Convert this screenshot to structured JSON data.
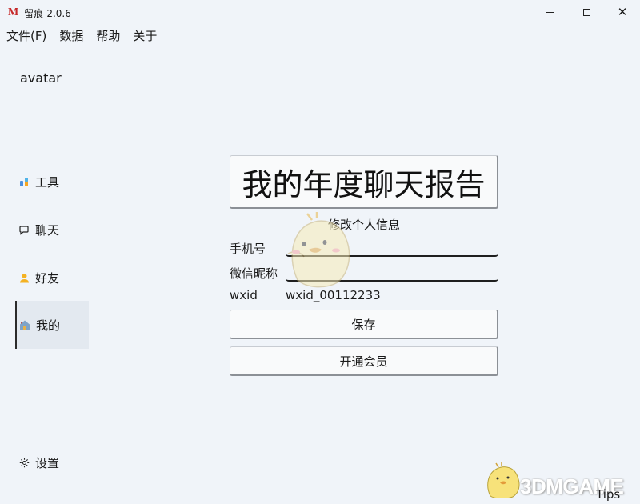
{
  "window": {
    "logo": "M",
    "title": "留痕-2.0.6"
  },
  "menu": [
    "文件(F)",
    "数据",
    "帮助",
    "关于"
  ],
  "sidebar": {
    "avatar": "avatar",
    "items": [
      {
        "label": "工具",
        "icon": "tools-icon"
      },
      {
        "label": "聊天",
        "icon": "chat-icon"
      },
      {
        "label": "好友",
        "icon": "friends-icon"
      },
      {
        "label": "我的",
        "icon": "home-icon",
        "active": true
      }
    ],
    "settings": {
      "label": "设置",
      "icon": "gear-icon"
    }
  },
  "main": {
    "report_button": "我的年度聊天报告",
    "section_title": "修改个人信息",
    "fields": {
      "phone_label": "手机号",
      "phone_value": "",
      "nickname_label": "微信昵称",
      "nickname_value": "",
      "wxid_label": "wxid",
      "wxid_value": "wxid_00112233"
    },
    "save_button": "保存",
    "vip_button": "开通会员"
  },
  "footer": {
    "tips": "Tips",
    "watermark": "3DMGAME"
  }
}
